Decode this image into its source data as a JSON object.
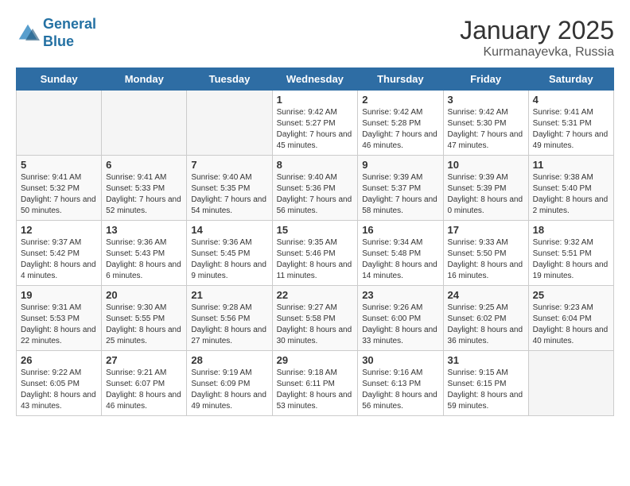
{
  "header": {
    "logo_line1": "General",
    "logo_line2": "Blue",
    "month": "January 2025",
    "location": "Kurmanayevka, Russia"
  },
  "weekdays": [
    "Sunday",
    "Monday",
    "Tuesday",
    "Wednesday",
    "Thursday",
    "Friday",
    "Saturday"
  ],
  "weeks": [
    [
      {
        "day": "",
        "info": ""
      },
      {
        "day": "",
        "info": ""
      },
      {
        "day": "",
        "info": ""
      },
      {
        "day": "1",
        "info": "Sunrise: 9:42 AM\nSunset: 5:27 PM\nDaylight: 7 hours and 45 minutes."
      },
      {
        "day": "2",
        "info": "Sunrise: 9:42 AM\nSunset: 5:28 PM\nDaylight: 7 hours and 46 minutes."
      },
      {
        "day": "3",
        "info": "Sunrise: 9:42 AM\nSunset: 5:30 PM\nDaylight: 7 hours and 47 minutes."
      },
      {
        "day": "4",
        "info": "Sunrise: 9:41 AM\nSunset: 5:31 PM\nDaylight: 7 hours and 49 minutes."
      }
    ],
    [
      {
        "day": "5",
        "info": "Sunrise: 9:41 AM\nSunset: 5:32 PM\nDaylight: 7 hours and 50 minutes."
      },
      {
        "day": "6",
        "info": "Sunrise: 9:41 AM\nSunset: 5:33 PM\nDaylight: 7 hours and 52 minutes."
      },
      {
        "day": "7",
        "info": "Sunrise: 9:40 AM\nSunset: 5:35 PM\nDaylight: 7 hours and 54 minutes."
      },
      {
        "day": "8",
        "info": "Sunrise: 9:40 AM\nSunset: 5:36 PM\nDaylight: 7 hours and 56 minutes."
      },
      {
        "day": "9",
        "info": "Sunrise: 9:39 AM\nSunset: 5:37 PM\nDaylight: 7 hours and 58 minutes."
      },
      {
        "day": "10",
        "info": "Sunrise: 9:39 AM\nSunset: 5:39 PM\nDaylight: 8 hours and 0 minutes."
      },
      {
        "day": "11",
        "info": "Sunrise: 9:38 AM\nSunset: 5:40 PM\nDaylight: 8 hours and 2 minutes."
      }
    ],
    [
      {
        "day": "12",
        "info": "Sunrise: 9:37 AM\nSunset: 5:42 PM\nDaylight: 8 hours and 4 minutes."
      },
      {
        "day": "13",
        "info": "Sunrise: 9:36 AM\nSunset: 5:43 PM\nDaylight: 8 hours and 6 minutes."
      },
      {
        "day": "14",
        "info": "Sunrise: 9:36 AM\nSunset: 5:45 PM\nDaylight: 8 hours and 9 minutes."
      },
      {
        "day": "15",
        "info": "Sunrise: 9:35 AM\nSunset: 5:46 PM\nDaylight: 8 hours and 11 minutes."
      },
      {
        "day": "16",
        "info": "Sunrise: 9:34 AM\nSunset: 5:48 PM\nDaylight: 8 hours and 14 minutes."
      },
      {
        "day": "17",
        "info": "Sunrise: 9:33 AM\nSunset: 5:50 PM\nDaylight: 8 hours and 16 minutes."
      },
      {
        "day": "18",
        "info": "Sunrise: 9:32 AM\nSunset: 5:51 PM\nDaylight: 8 hours and 19 minutes."
      }
    ],
    [
      {
        "day": "19",
        "info": "Sunrise: 9:31 AM\nSunset: 5:53 PM\nDaylight: 8 hours and 22 minutes."
      },
      {
        "day": "20",
        "info": "Sunrise: 9:30 AM\nSunset: 5:55 PM\nDaylight: 8 hours and 25 minutes."
      },
      {
        "day": "21",
        "info": "Sunrise: 9:28 AM\nSunset: 5:56 PM\nDaylight: 8 hours and 27 minutes."
      },
      {
        "day": "22",
        "info": "Sunrise: 9:27 AM\nSunset: 5:58 PM\nDaylight: 8 hours and 30 minutes."
      },
      {
        "day": "23",
        "info": "Sunrise: 9:26 AM\nSunset: 6:00 PM\nDaylight: 8 hours and 33 minutes."
      },
      {
        "day": "24",
        "info": "Sunrise: 9:25 AM\nSunset: 6:02 PM\nDaylight: 8 hours and 36 minutes."
      },
      {
        "day": "25",
        "info": "Sunrise: 9:23 AM\nSunset: 6:04 PM\nDaylight: 8 hours and 40 minutes."
      }
    ],
    [
      {
        "day": "26",
        "info": "Sunrise: 9:22 AM\nSunset: 6:05 PM\nDaylight: 8 hours and 43 minutes."
      },
      {
        "day": "27",
        "info": "Sunrise: 9:21 AM\nSunset: 6:07 PM\nDaylight: 8 hours and 46 minutes."
      },
      {
        "day": "28",
        "info": "Sunrise: 9:19 AM\nSunset: 6:09 PM\nDaylight: 8 hours and 49 minutes."
      },
      {
        "day": "29",
        "info": "Sunrise: 9:18 AM\nSunset: 6:11 PM\nDaylight: 8 hours and 53 minutes."
      },
      {
        "day": "30",
        "info": "Sunrise: 9:16 AM\nSunset: 6:13 PM\nDaylight: 8 hours and 56 minutes."
      },
      {
        "day": "31",
        "info": "Sunrise: 9:15 AM\nSunset: 6:15 PM\nDaylight: 8 hours and 59 minutes."
      },
      {
        "day": "",
        "info": ""
      }
    ]
  ]
}
